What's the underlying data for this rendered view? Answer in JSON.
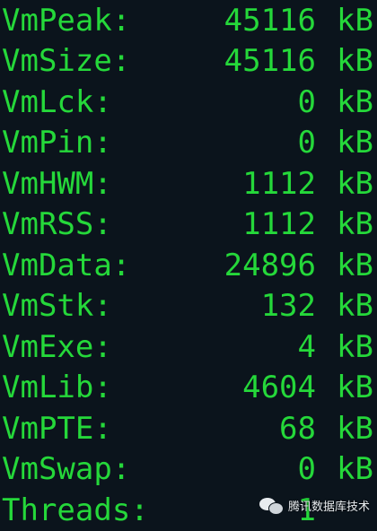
{
  "rows": [
    {
      "key": "VmPeak:",
      "value": "45116",
      "unit": "kB"
    },
    {
      "key": "VmSize:",
      "value": "45116",
      "unit": "kB"
    },
    {
      "key": "VmLck:",
      "value": "0",
      "unit": "kB"
    },
    {
      "key": "VmPin:",
      "value": "0",
      "unit": "kB"
    },
    {
      "key": "VmHWM:",
      "value": "1112",
      "unit": "kB"
    },
    {
      "key": "VmRSS:",
      "value": "1112",
      "unit": "kB"
    },
    {
      "key": "VmData:",
      "value": "24896",
      "unit": "kB"
    },
    {
      "key": "VmStk:",
      "value": "132",
      "unit": "kB"
    },
    {
      "key": "VmExe:",
      "value": "4",
      "unit": "kB"
    },
    {
      "key": "VmLib:",
      "value": "4604",
      "unit": "kB"
    },
    {
      "key": "VmPTE:",
      "value": "68",
      "unit": "kB"
    },
    {
      "key": "VmSwap:",
      "value": "0",
      "unit": "kB"
    },
    {
      "key": "Threads:",
      "value": "1",
      "unit": ""
    }
  ],
  "watermark": {
    "icon": "wechat-icon",
    "text": "腾讯数据库技术"
  },
  "colors": {
    "background": "#0b141c",
    "text": "#25d83a"
  }
}
